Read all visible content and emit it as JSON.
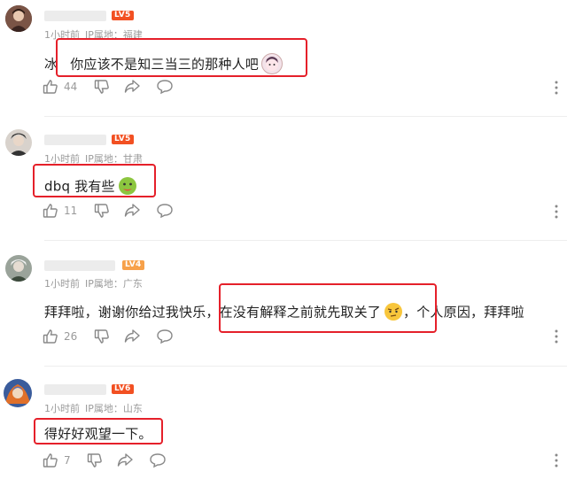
{
  "comments": [
    {
      "level": "LV5",
      "time": "1小时前",
      "ip": "IP属地：福建",
      "text_before": "冰",
      "text_highlight": "你应该不是知三当三的那种人吧",
      "text_after": "",
      "likes": "44",
      "level_color": "#f25022"
    },
    {
      "level": "LV5",
      "time": "1小时前",
      "ip": "IP属地：甘肃",
      "text_before": "",
      "text_highlight": "dbq 我有些",
      "text_after": "",
      "likes": "11",
      "level_color": "#f25022"
    },
    {
      "level": "LV4",
      "time": "1小时前",
      "ip": "IP属地：广东",
      "text_before": "拜拜啦，谢谢你给过我快乐，",
      "text_highlight": "在没有解释之前就先取关了",
      "text_after": "，个人原因，拜拜啦",
      "likes": "26",
      "level_color": "#f7a14a"
    },
    {
      "level": "LV6",
      "time": "1小时前",
      "ip": "IP属地：山东",
      "text_before": "",
      "text_highlight": "得好好观望一下。",
      "text_after": "",
      "likes": "7",
      "level_color": "#f25022"
    }
  ],
  "icons": [
    "thumbs-up-icon",
    "thumbs-down-icon",
    "share-icon",
    "comment-icon",
    "more-icon"
  ],
  "highlight_color": "#e5202a"
}
